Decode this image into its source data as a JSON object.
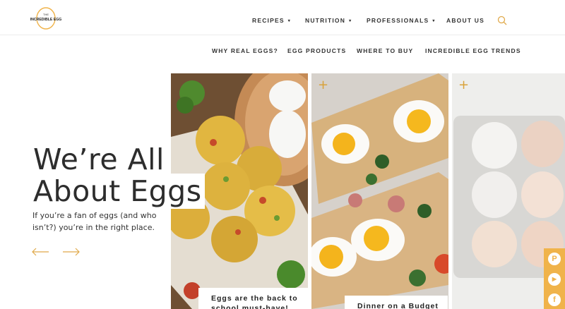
{
  "brand": {
    "logo_text_top": "THE",
    "logo_text_main": "INCREDIBLE EGG"
  },
  "main_nav": [
    {
      "label": "RECIPES",
      "has_dropdown": true
    },
    {
      "label": "NUTRITION",
      "has_dropdown": true
    },
    {
      "label": "PROFESSIONALS",
      "has_dropdown": true
    },
    {
      "label": "ABOUT US",
      "has_dropdown": false
    }
  ],
  "dropdown_glyph": "▾",
  "sub_nav": [
    "WHY REAL EGGS?",
    "EGG PRODUCTS",
    "WHERE TO BUY",
    "INCREDIBLE EGG TRENDS"
  ],
  "hero": {
    "title_line1": "We’re All",
    "title_line2": "About Eggs",
    "subtitle": "If you’re a fan of eggs (and who isn’t?) you’re in the right place."
  },
  "carousel": {
    "captions": [
      "Eggs are the back to school must-have!",
      "Dinner on a Budget"
    ]
  },
  "social": [
    {
      "icon": "pinterest-icon",
      "glyph": "P"
    },
    {
      "icon": "youtube-icon",
      "glyph": "▶"
    },
    {
      "icon": "facebook-icon",
      "glyph": "f"
    }
  ],
  "colors": {
    "accent": "#f0b34a",
    "text": "#2d2d2d"
  }
}
